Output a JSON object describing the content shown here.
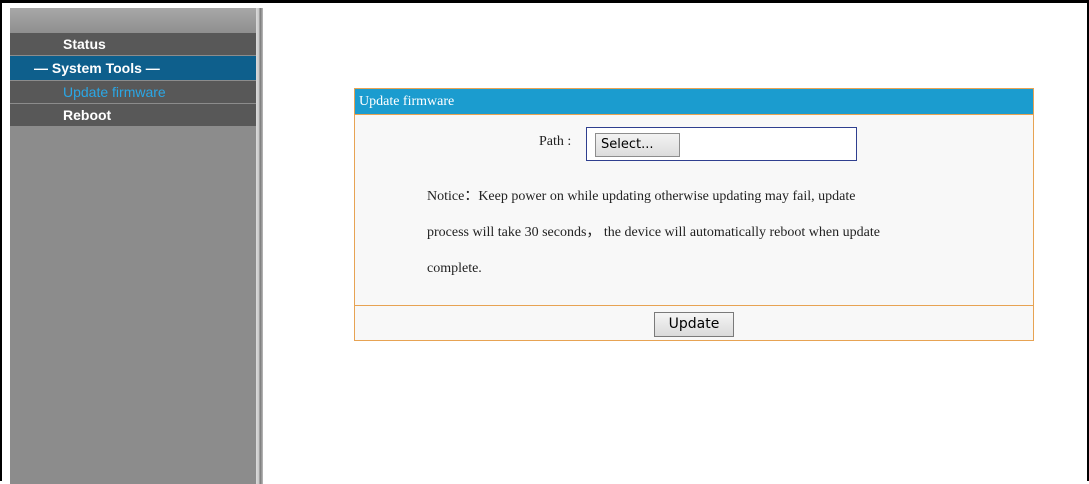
{
  "sidebar": {
    "items": [
      {
        "label": "Status"
      },
      {
        "label": "— System Tools —"
      },
      {
        "label": "Update firmware"
      },
      {
        "label": "Reboot"
      }
    ]
  },
  "panel": {
    "title": "Update firmware",
    "path_label": "Path :",
    "select_label": "Select...",
    "notice_line1": "Notice：Keep power on while updating otherwise updating may fail, update",
    "notice_line2": "process will take 30 seconds， the device will automatically reboot when update",
    "notice_line3": "complete.",
    "update_label": "Update"
  },
  "colors": {
    "header_blue": "#1b9ccf",
    "section_blue": "#0e5f8c",
    "active_link": "#2aa7e6",
    "panel_border": "#e7a353"
  }
}
